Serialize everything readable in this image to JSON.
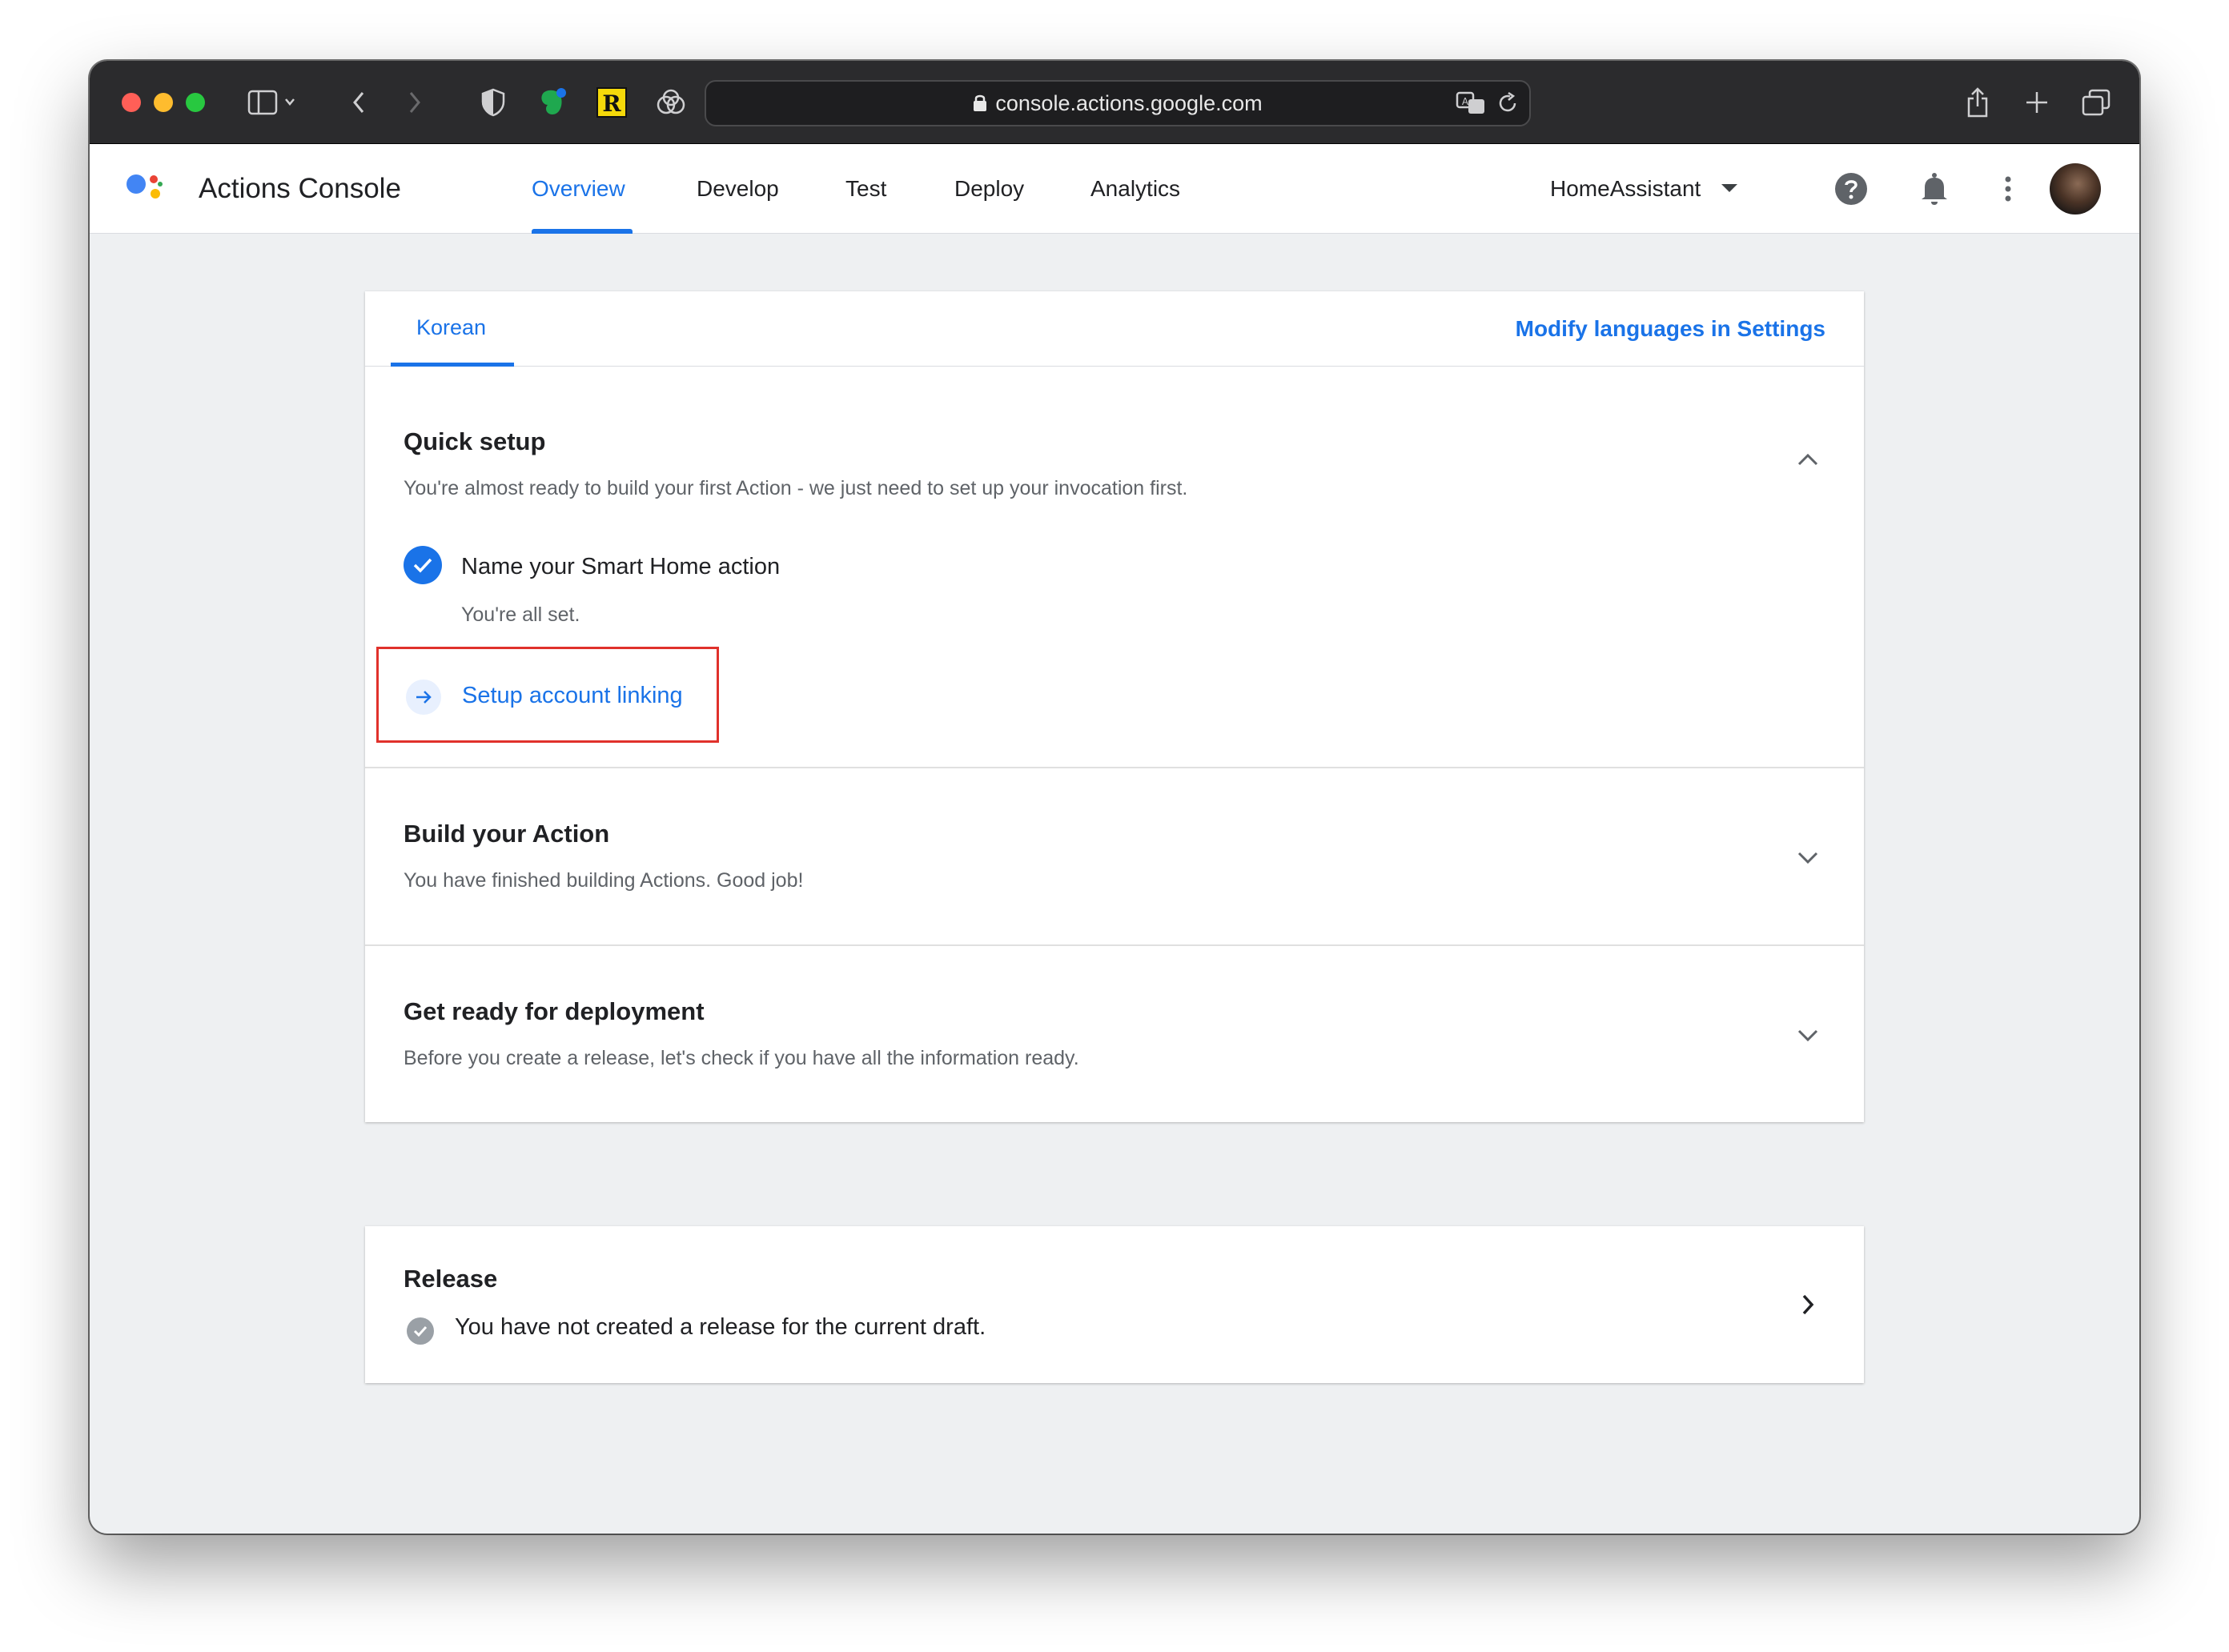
{
  "browser": {
    "url": "console.actions.google.com"
  },
  "app": {
    "title": "Actions Console",
    "nav": [
      {
        "label": "Overview",
        "active": true
      },
      {
        "label": "Develop",
        "active": false
      },
      {
        "label": "Test",
        "active": false
      },
      {
        "label": "Deploy",
        "active": false
      },
      {
        "label": "Analytics",
        "active": false
      }
    ],
    "project": "HomeAssistant",
    "accent_color": "#1a73e8"
  },
  "language": {
    "tab": "Korean",
    "modify_link": "Modify languages in Settings"
  },
  "quick_setup": {
    "title": "Quick setup",
    "description": "You're almost ready to build your first Action - we just need to set up your invocation first.",
    "steps": [
      {
        "label": "Name your Smart Home action",
        "sub": "You're all set.",
        "done": true
      },
      {
        "label": "Setup account linking",
        "done": false
      }
    ]
  },
  "build": {
    "title": "Build your Action",
    "description": "You have finished building Actions. Good job!"
  },
  "deploy": {
    "title": "Get ready for deployment",
    "description": "Before you create a release, let's check if you have all the information ready."
  },
  "release": {
    "title": "Release",
    "status": "You have not created a release for the current draft."
  }
}
